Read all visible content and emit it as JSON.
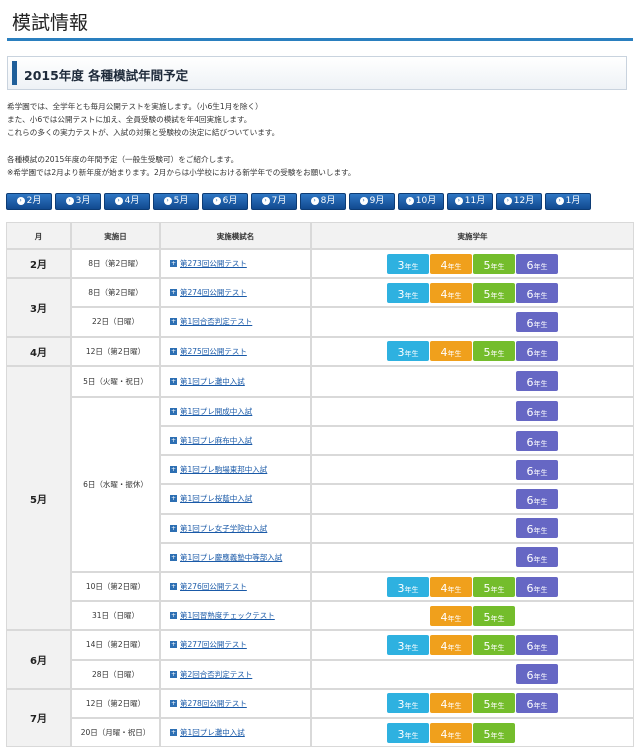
{
  "page_title": "模試情報",
  "section_title": "2015年度 各種模試年間予定",
  "intro_lines": [
    "希学園では、全学年とも毎月公開テストを実施します。（小6生1月を除く）",
    "また、小6では公開テストに加え、全員受験の模試を年4回実施します。",
    "これらの多くの実力テストが、入試の対策と受験校の決定に結びついています。",
    "各種模試の2015年度の年間予定（一般生受験可）をご紹介します。",
    "※希学園では2月より新年度が始まります。2月からは小学校における新学年での受験をお願いします。"
  ],
  "month_nav": [
    "2月",
    "3月",
    "4月",
    "5月",
    "6月",
    "7月",
    "8月",
    "9月",
    "10月",
    "11月",
    "12月",
    "1月"
  ],
  "nav_icon": "circle-arrow-icon",
  "table": {
    "headers": {
      "month": "月",
      "date": "実施日",
      "name": "実施模試名",
      "grades": "実施学年"
    },
    "grade_suffix": "年生",
    "grade_colors": {
      "3": "#2eb1e0",
      "4": "#f0a01c",
      "5": "#74bd2c",
      "6": "#6667c4"
    },
    "months": [
      {
        "month": "2月",
        "rows": [
          {
            "date": "8日（第2日曜）",
            "name": "第273回公開テスト",
            "grades": [
              "3",
              "4",
              "5",
              "6"
            ]
          }
        ]
      },
      {
        "month": "3月",
        "rows": [
          {
            "date": "8日（第2日曜）",
            "name": "第274回公開テスト",
            "grades": [
              "3",
              "4",
              "5",
              "6"
            ]
          },
          {
            "date": "22日（日曜）",
            "name": "第1回合否判定テスト",
            "grades": [
              "6"
            ]
          }
        ]
      },
      {
        "month": "4月",
        "rows": [
          {
            "date": "12日（第2日曜）",
            "name": "第275回公開テスト",
            "grades": [
              "3",
              "4",
              "5",
              "6"
            ]
          }
        ]
      },
      {
        "month": "5月",
        "rows": [
          {
            "date": "5日（火曜・祝日）",
            "name": "第1回プレ灘中入試",
            "grades": [
              "6"
            ]
          },
          {
            "date": "6日（水曜・振休）",
            "name": "第1回プレ開成中入試",
            "grades": [
              "6"
            ]
          },
          {
            "date": "",
            "name": "第1回プレ麻布中入試",
            "grades": [
              "6"
            ]
          },
          {
            "date": "",
            "name": "第1回プレ駒場東邦中入試",
            "grades": [
              "6"
            ]
          },
          {
            "date": "",
            "name": "第1回プレ桜蔭中入試",
            "grades": [
              "6"
            ]
          },
          {
            "date": "",
            "name": "第1回プレ女子学院中入試",
            "grades": [
              "6"
            ]
          },
          {
            "date": "",
            "name": "第1回プレ慶應義塾中等部入試",
            "grades": [
              "6"
            ]
          },
          {
            "date": "10日（第2日曜）",
            "name": "第276回公開テスト",
            "grades": [
              "3",
              "4",
              "5",
              "6"
            ]
          },
          {
            "date": "31日（日曜）",
            "name": "第1回習熟度チェックテスト",
            "grades": [
              "4",
              "5"
            ]
          }
        ]
      },
      {
        "month": "6月",
        "rows": [
          {
            "date": "14日（第2日曜）",
            "name": "第277回公開テスト",
            "grades": [
              "3",
              "4",
              "5",
              "6"
            ]
          },
          {
            "date": "28日（日曜）",
            "name": "第2回合否判定テスト",
            "grades": [
              "6"
            ]
          }
        ]
      },
      {
        "month": "7月",
        "rows": [
          {
            "date": "12日（第2日曜）",
            "name": "第278回公開テスト",
            "grades": [
              "3",
              "4",
              "5",
              "6"
            ]
          },
          {
            "date": "20日（月曜・祝日）",
            "name": "第1回プレ灘中入試",
            "grades": [
              "3",
              "4",
              "5"
            ]
          }
        ]
      }
    ]
  }
}
